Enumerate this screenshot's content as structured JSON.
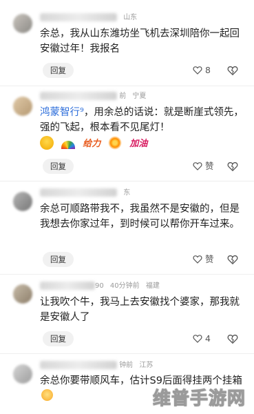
{
  "comments": [
    {
      "meta_time": "",
      "meta_location": "山东",
      "text": "余总，我从山东潍坊坐飞机去深圳陪你一起回安徽过年！我报名",
      "reply_label": "回复",
      "like_count": "8"
    },
    {
      "meta_time": "前",
      "meta_location": "宁夏",
      "mention": "鸿蒙智行",
      "mention_symbol": "⁹",
      "text": "，用余总的话说：就是断崖式领先，强的飞起，根本看不见尾灯！",
      "stickers": [
        "给力",
        "加油"
      ],
      "reply_label": "回复",
      "like_label": "赞"
    },
    {
      "meta_time": "",
      "meta_location": "东",
      "text": "余总可顺路带我不，我虽然不是安徽的，但是我想去你家过年，到时候可以帮你开车过来。",
      "reply_label": "回复",
      "like_label": "赞"
    },
    {
      "meta_suffix": "90",
      "meta_time": "40分钟前",
      "meta_location": "福建",
      "text": "让我吹个牛，我马上去安徽找个婆家，那我就是安徽人了",
      "reply_label": "回复",
      "like_count": "4"
    },
    {
      "meta_time": "钟前",
      "meta_location": "江苏",
      "text": "余总你要带顺风车，估计S9后面得挂两个挂箱"
    }
  ],
  "watermark": "维普手游网",
  "colors": {
    "mention": "#2f6fdb",
    "reply_bg": "#f1f1f1",
    "meta": "#9a9a9a"
  },
  "icons": {
    "like": "heart-outline-icon",
    "dislike": "broken-heart-icon"
  }
}
